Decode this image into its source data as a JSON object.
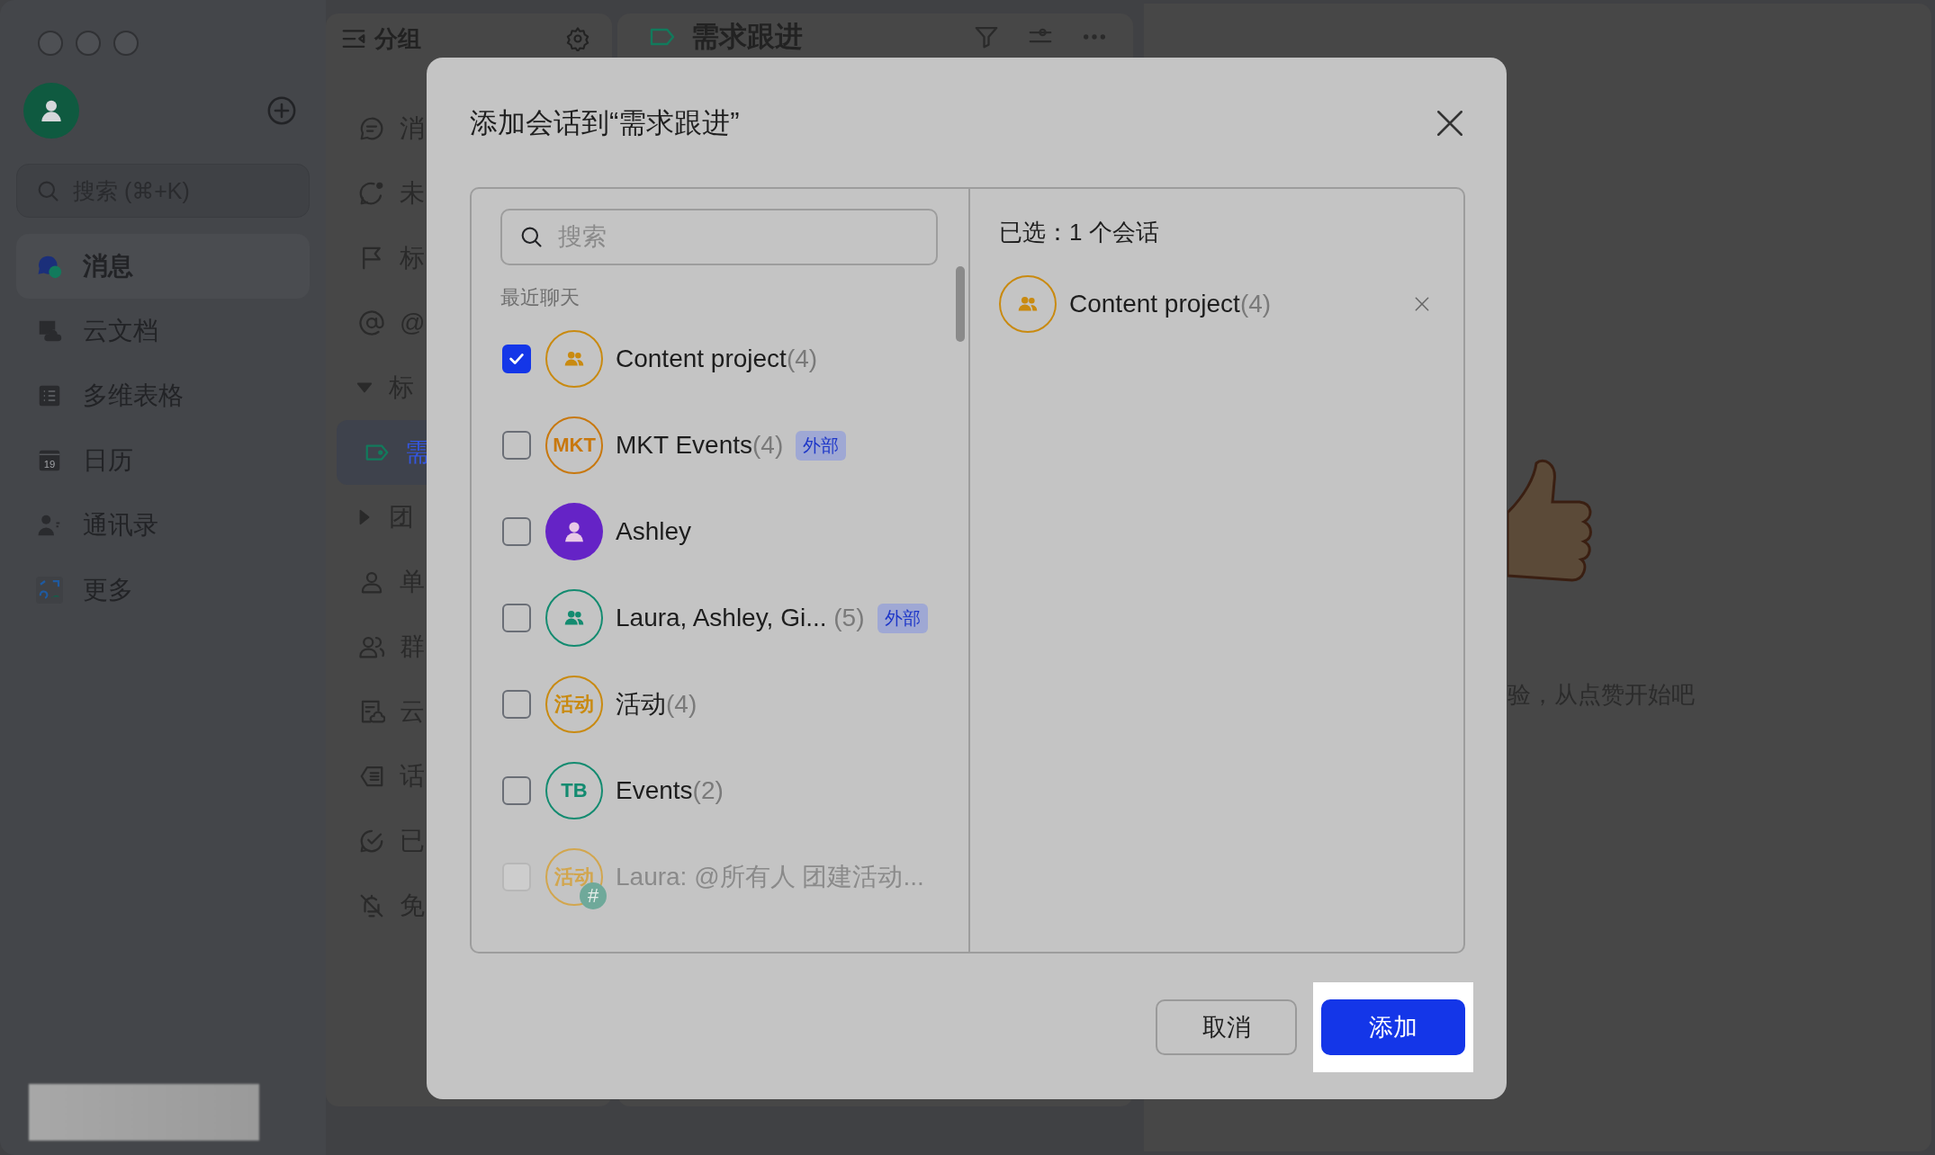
{
  "sidebar": {
    "search": {
      "placeholder": "搜索 (⌘+K)"
    },
    "nav": [
      {
        "label": "消息",
        "selected": true
      },
      {
        "label": "云文档",
        "selected": false
      },
      {
        "label": "多维表格",
        "selected": false
      },
      {
        "label": "日历",
        "selected": false,
        "icon_text": "19"
      },
      {
        "label": "通讯录",
        "selected": false
      },
      {
        "label": "更多",
        "selected": false
      }
    ]
  },
  "groups_panel": {
    "title": "分组",
    "items": [
      {
        "kind": "item",
        "label": "消",
        "selected": false
      },
      {
        "kind": "item",
        "label": "未",
        "selected": false
      },
      {
        "kind": "item",
        "label": "标",
        "selected": false
      },
      {
        "kind": "item",
        "label": "@",
        "selected": false
      },
      {
        "kind": "folder",
        "label": "标",
        "selected": false,
        "expanded": true,
        "children": [
          {
            "kind": "tag",
            "label": "需",
            "selected": true
          }
        ]
      },
      {
        "kind": "folder",
        "label": "团",
        "selected": false,
        "expanded": false
      },
      {
        "kind": "item",
        "label": "单",
        "selected": false
      },
      {
        "kind": "item",
        "label": "群",
        "selected": false
      },
      {
        "kind": "item",
        "label": "云",
        "selected": false
      },
      {
        "kind": "item",
        "label": "话",
        "selected": false
      },
      {
        "kind": "item",
        "label": "已",
        "selected": false
      },
      {
        "kind": "item",
        "label": "免",
        "selected": false
      }
    ]
  },
  "conversation_panel": {
    "title": "需求跟进"
  },
  "empty_state": {
    "text": "验，从点赞开始吧"
  },
  "dialog": {
    "title": "添加会话到“需求跟进”",
    "search": {
      "placeholder": "搜索"
    },
    "section_label": "最近聊天",
    "chats": [
      {
        "name": "Content project",
        "count": "(4)",
        "checked": true,
        "disabled": false,
        "avatar": {
          "kind": "group",
          "color": "#c98a10"
        }
      },
      {
        "name": "MKT Events",
        "count": "(4)",
        "checked": false,
        "disabled": false,
        "avatar": {
          "kind": "initials",
          "text": "MKT",
          "color": "#c8780e"
        },
        "tag": "外部"
      },
      {
        "name": "Ashley",
        "checked": false,
        "disabled": false,
        "avatar": {
          "kind": "person",
          "color": "#6523c6"
        }
      },
      {
        "name": "Laura, Ashley, Gi...",
        "count": " (5)",
        "checked": false,
        "disabled": false,
        "avatar": {
          "kind": "group",
          "color": "#138b70"
        },
        "tag": "外部"
      },
      {
        "name": "活动",
        "count": "(4)",
        "checked": false,
        "disabled": false,
        "avatar": {
          "kind": "initials",
          "text": "活动",
          "color": "#c98a10"
        }
      },
      {
        "name": "Events",
        "count": "(2)",
        "checked": false,
        "disabled": false,
        "avatar": {
          "kind": "initials",
          "text": "TB",
          "color": "#138b70"
        }
      },
      {
        "name": "Laura: @所有人 团建活动...",
        "checked": false,
        "disabled": true,
        "avatar": {
          "kind": "initials",
          "text": "活动",
          "color": "#d2a64e",
          "badge": "#"
        }
      }
    ],
    "selected_label": "已选：1 个会话",
    "selected": [
      {
        "name": "Content project",
        "count": "(4)",
        "avatar": {
          "kind": "group",
          "color": "#c98a10"
        }
      }
    ],
    "buttons": [
      {
        "label": "取消",
        "kind": "secondary",
        "highlighted": false
      },
      {
        "label": "添加",
        "kind": "primary",
        "highlighted": true
      }
    ]
  }
}
